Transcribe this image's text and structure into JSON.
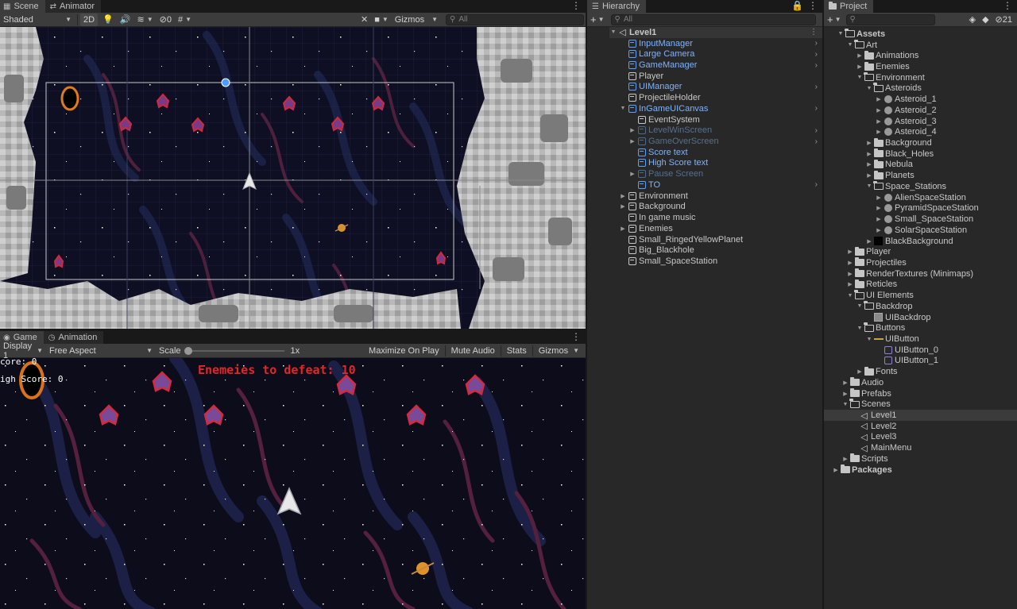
{
  "scene_panel": {
    "tabs": [
      {
        "label": "Scene"
      },
      {
        "label": "Animator"
      }
    ],
    "shading_mode": "Shaded",
    "mode_2d": "2D",
    "hidden_count": "0",
    "gizmos_label": "Gizmos",
    "search_placeholder": "All"
  },
  "game_panel": {
    "tabs": [
      {
        "label": "Game"
      },
      {
        "label": "Animation"
      }
    ],
    "display": "Display 1",
    "aspect": "Free Aspect",
    "scale_label": "Scale",
    "scale_value": "1x",
    "maximize_on_play": "Maximize On Play",
    "mute_audio": "Mute Audio",
    "stats": "Stats",
    "gizmos": "Gizmos",
    "hud": {
      "score": "core: 0",
      "high_score": "igh Score: 0",
      "enemies_to_defeat": "Enemeies to defeat: 10"
    }
  },
  "hierarchy": {
    "title": "Hierarchy",
    "search_placeholder": "All",
    "items": [
      {
        "label": "Level1",
        "depth": 0,
        "expanded": true,
        "kind": "scene"
      },
      {
        "label": "InputManager",
        "depth": 1,
        "kind": "prefab",
        "chevron": true
      },
      {
        "label": "Large Camera",
        "depth": 1,
        "kind": "prefab",
        "chevron": true
      },
      {
        "label": "GameManager",
        "depth": 1,
        "kind": "prefab",
        "chevron": true
      },
      {
        "label": "Player",
        "depth": 1,
        "kind": "object"
      },
      {
        "label": "UIManager",
        "depth": 1,
        "kind": "prefab",
        "chevron": true
      },
      {
        "label": "ProjectileHolder",
        "depth": 1,
        "kind": "object"
      },
      {
        "label": "InGameUICanvas",
        "depth": 1,
        "kind": "prefab",
        "expanded": true,
        "chevron": true
      },
      {
        "label": "EventSystem",
        "depth": 2,
        "kind": "object"
      },
      {
        "label": "LevelWinScreen",
        "depth": 2,
        "kind": "prefab-dim",
        "collapsed": true,
        "chevron": true
      },
      {
        "label": "GameOverScreen",
        "depth": 2,
        "kind": "prefab-dim",
        "collapsed": true,
        "chevron": true
      },
      {
        "label": "Score text",
        "depth": 2,
        "kind": "prefab"
      },
      {
        "label": "High Score text",
        "depth": 2,
        "kind": "prefab"
      },
      {
        "label": "Pause Screen",
        "depth": 2,
        "kind": "prefab-dim",
        "collapsed": true
      },
      {
        "label": "TO",
        "depth": 2,
        "kind": "prefab",
        "chevron": true
      },
      {
        "label": "Environment",
        "depth": 1,
        "kind": "object",
        "collapsed": true
      },
      {
        "label": "Background",
        "depth": 1,
        "kind": "object",
        "collapsed": true
      },
      {
        "label": "In game music",
        "depth": 1,
        "kind": "object"
      },
      {
        "label": "Enemies",
        "depth": 1,
        "kind": "object",
        "collapsed": true
      },
      {
        "label": "Small_RingedYellowPlanet",
        "depth": 1,
        "kind": "object"
      },
      {
        "label": "Big_Blackhole",
        "depth": 1,
        "kind": "object"
      },
      {
        "label": "Small_SpaceStation",
        "depth": 1,
        "kind": "object"
      }
    ]
  },
  "project": {
    "title": "Project",
    "hidden_count": "21",
    "items": [
      {
        "label": "Assets",
        "depth": 0,
        "kind": "folder-open",
        "bold": true
      },
      {
        "label": "Art",
        "depth": 1,
        "kind": "folder-open"
      },
      {
        "label": "Animations",
        "depth": 2,
        "kind": "folder",
        "collapsed": true
      },
      {
        "label": "Enemies",
        "depth": 2,
        "kind": "folder",
        "collapsed": true
      },
      {
        "label": "Environment",
        "depth": 2,
        "kind": "folder-open"
      },
      {
        "label": "Asteroids",
        "depth": 3,
        "kind": "folder-open"
      },
      {
        "label": "Asteroid_1",
        "depth": 4,
        "kind": "sprite",
        "collapsed": true
      },
      {
        "label": "Asteroid_2",
        "depth": 4,
        "kind": "sprite",
        "collapsed": true
      },
      {
        "label": "Asteroid_3",
        "depth": 4,
        "kind": "sprite",
        "collapsed": true
      },
      {
        "label": "Asteroid_4",
        "depth": 4,
        "kind": "sprite",
        "collapsed": true
      },
      {
        "label": "Background",
        "depth": 3,
        "kind": "folder",
        "collapsed": true
      },
      {
        "label": "Black_Holes",
        "depth": 3,
        "kind": "folder",
        "collapsed": true
      },
      {
        "label": "Nebula",
        "depth": 3,
        "kind": "folder",
        "collapsed": true
      },
      {
        "label": "Planets",
        "depth": 3,
        "kind": "folder",
        "collapsed": true
      },
      {
        "label": "Space_Stations",
        "depth": 3,
        "kind": "folder-open"
      },
      {
        "label": "AlienSpaceStation",
        "depth": 4,
        "kind": "sprite",
        "collapsed": true
      },
      {
        "label": "PyramidSpaceStation",
        "depth": 4,
        "kind": "sprite",
        "collapsed": true
      },
      {
        "label": "Small_SpaceStation",
        "depth": 4,
        "kind": "sprite",
        "collapsed": true
      },
      {
        "label": "SolarSpaceStation",
        "depth": 4,
        "kind": "sprite",
        "collapsed": true
      },
      {
        "label": "BlackBackground",
        "depth": 3,
        "kind": "black",
        "collapsed": true
      },
      {
        "label": "Player",
        "depth": 1,
        "kind": "folder",
        "collapsed": true
      },
      {
        "label": "Projectiles",
        "depth": 1,
        "kind": "folder",
        "collapsed": true
      },
      {
        "label": "RenderTextures (Minimaps)",
        "depth": 1,
        "kind": "folder",
        "collapsed": true
      },
      {
        "label": "Reticles",
        "depth": 1,
        "kind": "folder",
        "collapsed": true
      },
      {
        "label": "UI Elements",
        "depth": 1,
        "kind": "folder-open"
      },
      {
        "label": "Backdrop",
        "depth": 2,
        "kind": "folder-open"
      },
      {
        "label": "UIBackdrop",
        "depth": 3,
        "kind": "gray"
      },
      {
        "label": "Buttons",
        "depth": 2,
        "kind": "folder-open"
      },
      {
        "label": "UIButton",
        "depth": 3,
        "kind": "line",
        "expanded": true
      },
      {
        "label": "UIButton_0",
        "depth": 4,
        "kind": "button"
      },
      {
        "label": "UIButton_1",
        "depth": 4,
        "kind": "button"
      },
      {
        "label": "Fonts",
        "depth": 2,
        "kind": "folder",
        "collapsed": true
      },
      {
        "label": "Audio",
        "depth": 0.5,
        "kind": "folder",
        "collapsed": true
      },
      {
        "label": "Prefabs",
        "depth": 0.5,
        "kind": "folder",
        "collapsed": true
      },
      {
        "label": "Scenes",
        "depth": 0.5,
        "kind": "folder-open"
      },
      {
        "label": "Level1",
        "depth": 1.5,
        "kind": "scene",
        "selected": true
      },
      {
        "label": "Level2",
        "depth": 1.5,
        "kind": "scene"
      },
      {
        "label": "Level3",
        "depth": 1.5,
        "kind": "scene"
      },
      {
        "label": "MainMenu",
        "depth": 1.5,
        "kind": "scene"
      },
      {
        "label": "Scripts",
        "depth": 0.5,
        "kind": "folder",
        "collapsed": true
      },
      {
        "label": "Packages",
        "depth": -0.5,
        "kind": "folder",
        "collapsed": true,
        "bold": true
      }
    ]
  },
  "colors": {
    "prefab": "#7cb3ff",
    "hud_red": "#e32626",
    "selection": "#3b3b3b"
  }
}
